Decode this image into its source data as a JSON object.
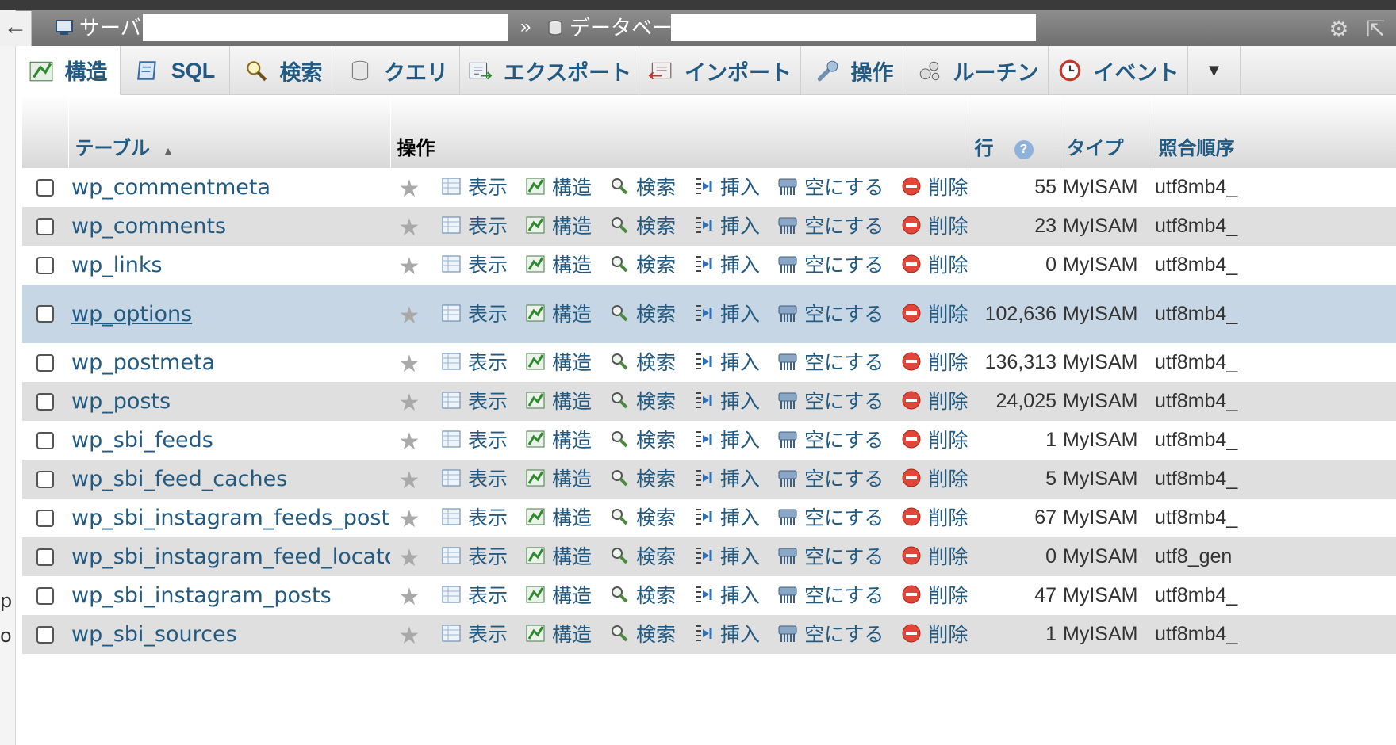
{
  "nav": {
    "back": "←",
    "server_label": "サーバ",
    "server_fragment": ":",
    "separator": "»",
    "database_label": "データベース"
  },
  "tabs": [
    {
      "label": "構造",
      "icon": "structure-icon"
    },
    {
      "label": "SQL",
      "icon": "sql-icon"
    },
    {
      "label": "検索",
      "icon": "search-icon"
    },
    {
      "label": "クエリ",
      "icon": "query-icon"
    },
    {
      "label": "エクスポート",
      "icon": "export-icon"
    },
    {
      "label": "インポート",
      "icon": "import-icon"
    },
    {
      "label": "操作",
      "icon": "wrench-icon"
    },
    {
      "label": "ルーチン",
      "icon": "routines-icon"
    },
    {
      "label": "イベント",
      "icon": "events-icon"
    },
    {
      "label": "▼",
      "icon": "more-icon"
    }
  ],
  "table": {
    "headers": {
      "table": "テーブル",
      "sort_indicator": "▲",
      "operations": "操作",
      "rows": "行",
      "type": "タイプ",
      "collation": "照合順序"
    },
    "actions": {
      "browse": "表示",
      "structure": "構造",
      "search": "検索",
      "insert": "挿入",
      "empty": "空にする",
      "drop": "削除"
    },
    "rows": [
      {
        "name": "wp_commentmeta",
        "rows": "55",
        "type": "MyISAM",
        "collation": "utf8mb4_"
      },
      {
        "name": "wp_comments",
        "rows": "23",
        "type": "MyISAM",
        "collation": "utf8mb4_"
      },
      {
        "name": "wp_links",
        "rows": "0",
        "type": "MyISAM",
        "collation": "utf8mb4_"
      },
      {
        "name": "wp_options",
        "rows": "102,636",
        "type": "MyISAM",
        "collation": "utf8mb4_"
      },
      {
        "name": "wp_postmeta",
        "rows": "136,313",
        "type": "MyISAM",
        "collation": "utf8mb4_"
      },
      {
        "name": "wp_posts",
        "rows": "24,025",
        "type": "MyISAM",
        "collation": "utf8mb4_"
      },
      {
        "name": "wp_sbi_feeds",
        "rows": "1",
        "type": "MyISAM",
        "collation": "utf8mb4_"
      },
      {
        "name": "wp_sbi_feed_caches",
        "rows": "5",
        "type": "MyISAM",
        "collation": "utf8mb4_"
      },
      {
        "name": "wp_sbi_instagram_feeds_posts",
        "rows": "67",
        "type": "MyISAM",
        "collation": "utf8mb4_"
      },
      {
        "name": "wp_sbi_instagram_feed_locator",
        "rows": "0",
        "type": "MyISAM",
        "collation": "utf8_gen"
      },
      {
        "name": "wp_sbi_instagram_posts",
        "rows": "47",
        "type": "MyISAM",
        "collation": "utf8mb4_"
      },
      {
        "name": "wp_sbi_sources",
        "rows": "1",
        "type": "MyISAM",
        "collation": "utf8mb4_"
      }
    ]
  },
  "gutter": {
    "frag1": "p",
    "frag2": "o"
  },
  "colors": {
    "link": "#235a81",
    "highlight_row": "#c7d6e4",
    "even_row": "#dfdfdf",
    "server_bar": "#7a7a7a"
  }
}
